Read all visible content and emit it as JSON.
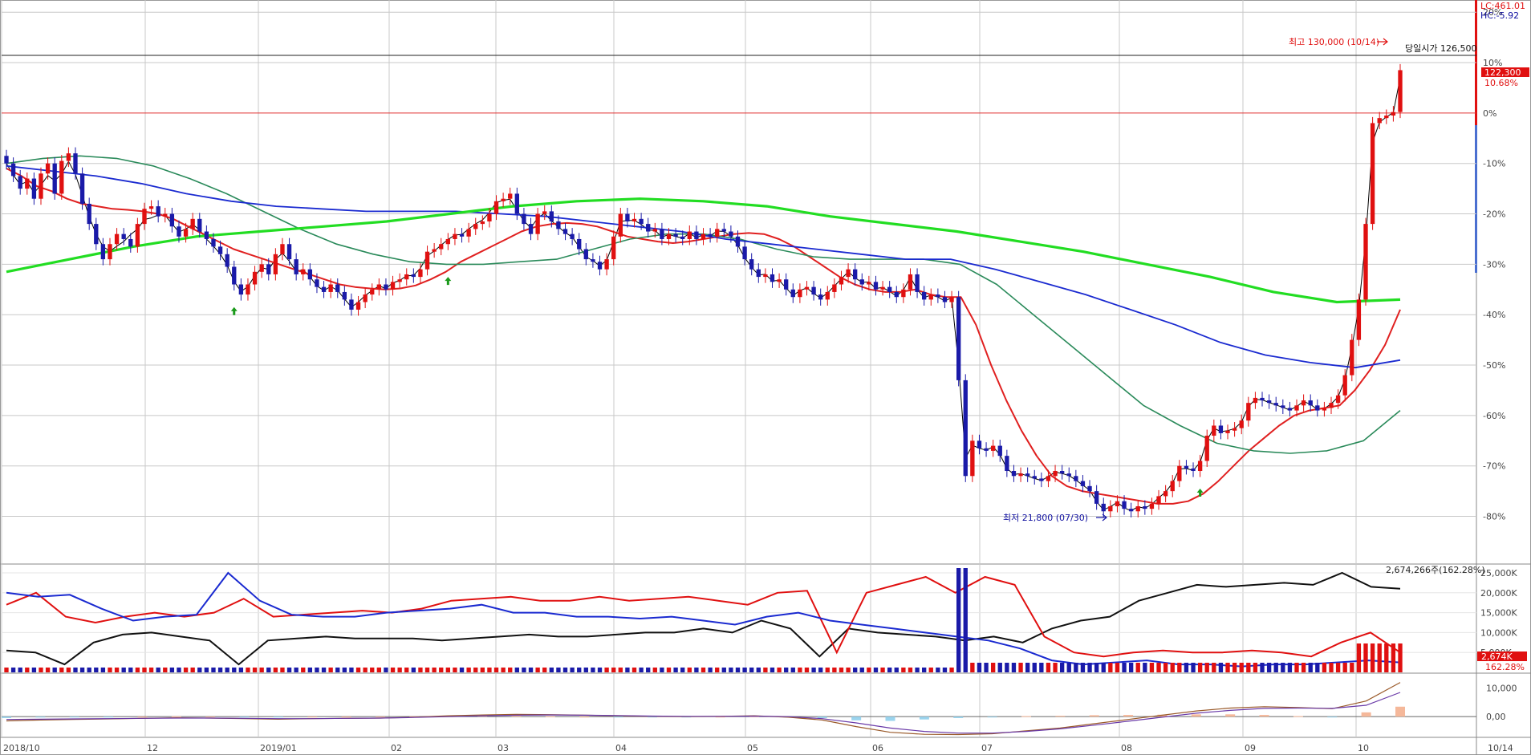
{
  "header": {
    "lc_label": "LC:461.01",
    "hc_label": "HC:-5.92"
  },
  "annotations": {
    "high": "최고 130,000 (10/14)",
    "open_today": "당일시가 126,500",
    "low": "최저 21,800 (07/30)"
  },
  "price_box": {
    "price": "122,300",
    "change": "10.68%"
  },
  "volume_panel": {
    "summary": "2,674,266주(162.28%)",
    "box_value": "2,674K",
    "box_pct": "162.28%"
  },
  "colors": {
    "up": "#e01010",
    "down": "#1a1aa8",
    "ma5": "#000000",
    "ma20": "#e02020",
    "ma60": "#2a8a5a",
    "ma120": "#1a2ad0",
    "ma240": "#22dd22",
    "grid": "#c8c8c8"
  },
  "chart_data": [
    {
      "type": "candlestick",
      "title": "",
      "x_ticks": [
        "2018/10",
        "12",
        "2019/01",
        "02",
        "03",
        "04",
        "05",
        "06",
        "07",
        "08",
        "09",
        "10",
        "10/14"
      ],
      "y_ticks": [
        "20%",
        "10%",
        "0%",
        "-10%",
        "-20%",
        "-30%",
        "-40%",
        "-50%",
        "-60%",
        "-70%",
        "-80%"
      ],
      "ylim": [
        -89.3,
        22.1
      ],
      "grid": true,
      "series": [
        {
          "name": "price",
          "values": [
            -10.0,
            -12.5,
            -15.0,
            -13.0,
            -17.0,
            -12.0,
            -10.0,
            -16.0,
            -9.5,
            -8.0,
            -12.0,
            -18.0,
            -22.0,
            -26.0,
            -29.0,
            -26.0,
            -24.0,
            -25.0,
            -26.5,
            -22.0,
            -19.0,
            -18.5,
            -20.5,
            -20.0,
            -22.5,
            -24.5,
            -23.0,
            -21.0,
            -23.5,
            -25.0,
            -26.5,
            -28.0,
            -30.5,
            -34.0,
            -36.0,
            -34.0,
            -31.5,
            -30.0,
            -32.0,
            -28.0,
            -26.0,
            -29.0,
            -32.0,
            -31.0,
            -33.0,
            -34.5,
            -35.5,
            -34.0,
            -35.5,
            -37.0,
            -39.0,
            -37.5,
            -36.0,
            -35.0,
            -34.0,
            -35.0,
            -33.5,
            -33.0,
            -32.0,
            -32.5,
            -31.0,
            -27.5,
            -27.0,
            -26.0,
            -25.0,
            -24.0,
            -24.5,
            -23.0,
            -22.0,
            -21.5,
            -20.0,
            -17.5,
            -17.0,
            -16.0,
            -20.0,
            -22.0,
            -24.0,
            -20.0,
            -19.5,
            -21.5,
            -23.0,
            -24.0,
            -25.0,
            -27.0,
            -29.0,
            -29.5,
            -31.0,
            -29.0,
            -24.5,
            -20.0,
            -21.5,
            -21.0,
            -22.0,
            -23.5,
            -23.0,
            -25.0,
            -24.0,
            -24.5,
            -25.0,
            -23.5,
            -25.0,
            -24.0,
            -24.5,
            -23.0,
            -23.5,
            -24.5,
            -26.5,
            -29.0,
            -31.0,
            -32.5,
            -32.0,
            -33.5,
            -33.0,
            -35.0,
            -36.5,
            -35.0,
            -34.5,
            -36.0,
            -37.0,
            -35.5,
            -34.0,
            -32.5,
            -31.0,
            -33.0,
            -34.0,
            -33.5,
            -35.0,
            -34.5,
            -35.5,
            -36.5,
            -35.0,
            -32.0,
            -35.5,
            -37.0,
            -36.0,
            -36.5,
            -37.5,
            -36.5,
            -53.0,
            -72.0,
            -65.0,
            -66.5,
            -67.0,
            -66.0,
            -68.0,
            -71.0,
            -72.0,
            -71.5,
            -72.0,
            -72.5,
            -73.0,
            -72.0,
            -71.0,
            -71.5,
            -72.0,
            -73.0,
            -74.0,
            -75.0,
            -77.5,
            -79.0,
            -78.0,
            -77.0,
            -78.5,
            -79.0,
            -78.0,
            -78.5,
            -77.5,
            -76.0,
            -75.0,
            -73.0,
            -70.0,
            -70.5,
            -71.0,
            -69.0,
            -64.0,
            -62.0,
            -63.5,
            -63.0,
            -62.5,
            -61.0,
            -57.5,
            -56.5,
            -57.0,
            -57.5,
            -58.0,
            -58.5,
            -59.0,
            -58.0,
            -57.0,
            -58.0,
            -59.0,
            -58.5,
            -57.5,
            -56.0,
            -52.0,
            -45.0,
            -37.0,
            -22.0,
            -2.0,
            -1.0,
            -0.5,
            0.2,
            8.5
          ]
        },
        {
          "name": "MA5",
          "values": [
            -10.0,
            -12.3,
            -14.2,
            -13.6,
            -15.8,
            -14.3,
            -12.4,
            -13.4,
            -12.1,
            -9.6,
            -12.2,
            -16.3,
            -20.6,
            -24.0,
            -26.5,
            -27.4,
            -26.4,
            -25.5,
            -24.1,
            -23.0,
            -21.1,
            -20.8,
            -20.2,
            -20.3,
            -22.0,
            -23.6,
            -23.0,
            -22.1,
            -23.2,
            -25.0,
            -26.4,
            -28.0,
            -30.2,
            -33.4,
            -35.4,
            -34.4,
            -32.3,
            -30.7,
            -31.0,
            -29.0,
            -27.8,
            -29.4,
            -31.4,
            -31.1,
            -32.5,
            -34.3,
            -35.2,
            -34.4,
            -35.2,
            -36.9,
            -38.5,
            -37.5,
            -36.2,
            -35.2,
            -34.3,
            -34.8,
            -33.7,
            -33.2,
            -32.3,
            -32.2,
            -30.8,
            -28.3,
            -27.4,
            -26.2,
            -25.1,
            -24.2,
            -24.1,
            -23.0,
            -22.0,
            -21.2,
            -19.7,
            -17.8,
            -17.3,
            -17.1,
            -19.3,
            -21.4,
            -22.8,
            -20.8,
            -19.9,
            -21.4,
            -22.6,
            -23.7,
            -24.6,
            -26.5,
            -28.5,
            -29.3,
            -30.3,
            -29.2,
            -25.6,
            -21.5,
            -21.3,
            -21.3,
            -22.1,
            -23.2,
            -23.3,
            -24.6,
            -24.1,
            -24.5,
            -24.8,
            -23.9,
            -24.7,
            -24.2,
            -24.4,
            -23.4,
            -23.5,
            -24.4,
            -26.2,
            -28.7,
            -30.6,
            -32.1,
            -32.0,
            -33.3,
            -33.2,
            -34.7,
            -36.2,
            -35.2,
            -34.7,
            -35.8,
            -36.7,
            -35.7,
            -34.3,
            -32.9,
            -31.5,
            -32.7,
            -33.6,
            -33.5,
            -34.8,
            -34.6,
            -35.4,
            -36.3,
            -35.1,
            -32.6,
            -35.0,
            -36.6,
            -36.1,
            -36.5,
            -37.3,
            -36.6,
            -50.1,
            -68.4,
            -65.9,
            -66.5,
            -66.9,
            -66.2,
            -67.8,
            -70.5,
            -71.7,
            -71.5,
            -72.0,
            -72.5,
            -72.9,
            -72.1,
            -71.2,
            -71.5,
            -71.9,
            -72.8,
            -73.8,
            -74.8,
            -77.1,
            -78.7,
            -78.1,
            -77.2,
            -78.3,
            -78.9,
            -78.1,
            -78.4,
            -77.6,
            -76.3,
            -75.2,
            -73.4,
            -70.6,
            -70.5,
            -70.9,
            -69.3,
            -64.9,
            -62.5,
            -63.2,
            -63.0,
            -62.6,
            -61.3,
            -58.2,
            -56.8,
            -56.9,
            -57.4,
            -57.9,
            -58.4,
            -58.9,
            -58.2,
            -57.2,
            -57.8,
            -58.8,
            -58.6,
            -57.7,
            -56.3,
            -52.8,
            -46.4,
            -38.6,
            -25.0,
            -5.8,
            -1.8,
            -0.8,
            0.1,
            7.0
          ]
        },
        {
          "name": "MA20",
          "values": [
            -11.0,
            -12.5,
            -14.5,
            -15.5,
            -17.0,
            -18.0,
            -18.5,
            -19.0,
            -19.2,
            -19.5,
            -20.0,
            -21.0,
            -22.5,
            -24.0,
            -25.5,
            -27.0,
            -28.0,
            -29.0,
            -30.0,
            -31.0,
            -32.0,
            -33.0,
            -34.0,
            -34.5,
            -34.8,
            -35.0,
            -34.8,
            -34.2,
            -33.0,
            -31.5,
            -29.5,
            -28.0,
            -26.5,
            -25.0,
            -23.5,
            -22.5,
            -22.0,
            -21.8,
            -22.0,
            -22.5,
            -23.5,
            -24.5,
            -25.0,
            -25.5,
            -25.8,
            -25.5,
            -25.0,
            -24.5,
            -24.0,
            -23.8,
            -24.0,
            -25.0,
            -26.5,
            -28.5,
            -30.5,
            -32.5,
            -34.0,
            -35.0,
            -35.5,
            -35.5,
            -35.0,
            -36.0,
            -36.5,
            -36.5,
            -42.0,
            -50.0,
            -57.0,
            -63.0,
            -68.0,
            -72.0,
            -74.0,
            -75.0,
            -75.5,
            -76.0,
            -76.5,
            -77.0,
            -77.5,
            -77.5,
            -77.0,
            -75.5,
            -73.0,
            -70.0,
            -67.0,
            -64.5,
            -62.0,
            -60.0,
            -59.0,
            -58.5,
            -58.0,
            -55.0,
            -51.0,
            -46.0,
            -39.0
          ]
        },
        {
          "name": "MA60",
          "values": [
            -10.0,
            -9.0,
            -8.5,
            -9.0,
            -10.5,
            -13.0,
            -16.0,
            -19.5,
            -23.0,
            -26.0,
            -28.0,
            -29.5,
            -30.0,
            -30.0,
            -29.5,
            -29.0,
            -27.0,
            -25.0,
            -24.0,
            -24.0,
            -25.0,
            -27.0,
            -28.5,
            -29.0,
            -29.0,
            -29.0,
            -30.0,
            -34.0,
            -40.0,
            -46.0,
            -52.0,
            -58.0,
            -62.0,
            -65.5,
            -67.0,
            -67.5,
            -67.0,
            -65.0,
            -59.0
          ]
        },
        {
          "name": "MA120",
          "values": [
            -10.5,
            -11.5,
            -12.5,
            -14.0,
            -16.0,
            -17.5,
            -18.5,
            -19.0,
            -19.5,
            -19.5,
            -19.5,
            -20.0,
            -20.5,
            -21.5,
            -22.5,
            -23.5,
            -25.0,
            -26.0,
            -27.0,
            -28.0,
            -29.0,
            -29.0,
            -31.0,
            -33.5,
            -36.0,
            -39.0,
            -42.0,
            -45.5,
            -48.0,
            -49.5,
            -50.5,
            -49.0
          ]
        },
        {
          "name": "MA240",
          "values": [
            -31.5,
            -29.0,
            -26.5,
            -24.5,
            -23.5,
            -22.5,
            -21.5,
            -20.0,
            -18.5,
            -17.5,
            -17.0,
            -17.5,
            -18.5,
            -20.5,
            -22.0,
            -23.5,
            -25.5,
            -27.5,
            -30.0,
            -32.5,
            -35.5,
            -37.5,
            -37.0
          ]
        }
      ]
    },
    {
      "type": "line",
      "title": "",
      "y_ticks": [
        "25,000K",
        "20,000K",
        "15,000K",
        "10,000K",
        "5,000K"
      ],
      "ylim": [
        0,
        25000
      ],
      "series": [
        {
          "name": "line-black",
          "values": [
            5500,
            5000,
            2000,
            7500,
            9500,
            10000,
            9000,
            8000,
            2000,
            8000,
            8500,
            9000,
            8500,
            8500,
            8500,
            8000,
            8500,
            9000,
            9500,
            9000,
            9000,
            9500,
            10000,
            10000,
            11000,
            10000,
            13000,
            11000,
            4000,
            11000,
            10000,
            9500,
            9000,
            8000,
            9000,
            7500,
            11000,
            13000,
            14000,
            18000,
            20000,
            22000,
            21500,
            22000,
            22500,
            22000,
            25000,
            21500,
            21000
          ]
        },
        {
          "name": "line-red",
          "values": [
            17000,
            20000,
            14000,
            12500,
            14000,
            15000,
            14000,
            15000,
            18500,
            14000,
            14500,
            15000,
            15500,
            15000,
            16000,
            18000,
            18500,
            19000,
            18000,
            18000,
            19000,
            18000,
            18500,
            19000,
            18000,
            17000,
            20000,
            20500,
            5000,
            20000,
            22000,
            24000,
            20000,
            24000,
            22000,
            9000,
            5000,
            4000,
            5000,
            5500,
            5000,
            5000,
            5500,
            5000,
            4000,
            7500,
            10000,
            5000
          ]
        },
        {
          "name": "line-blue",
          "values": [
            20000,
            19000,
            19500,
            16000,
            13000,
            14000,
            14500,
            25000,
            18000,
            14500,
            14000,
            14000,
            15000,
            15500,
            16000,
            17000,
            15000,
            15000,
            14000,
            14000,
            13500,
            14000,
            13000,
            12000,
            14000,
            15000,
            13000,
            12000,
            11000,
            10000,
            9000,
            8000,
            6000,
            3000,
            2000,
            2500,
            3000,
            2000,
            2000,
            1500,
            2000,
            2000,
            2500,
            3000,
            2500
          ]
        }
      ]
    },
    {
      "type": "bar",
      "title": "",
      "y_ticks": [
        "10,000",
        "0,00"
      ],
      "ylim": [
        -7000,
        15000
      ],
      "series": [
        {
          "name": "macd",
          "values": [
            -1500,
            -1200,
            -1000,
            -800,
            -600,
            -400,
            -500,
            -700,
            -900,
            -700,
            -600,
            -500,
            -200,
            300,
            600,
            800,
            700,
            500,
            300,
            100,
            0,
            100,
            300,
            -200,
            -1200,
            -3500,
            -5500,
            -6200,
            -6300,
            -6000,
            -5000,
            -4000,
            -2500,
            -1000,
            500,
            2000,
            3000,
            3500,
            3200,
            2800,
            5500,
            12000
          ]
        },
        {
          "name": "signal",
          "values": [
            -1000,
            -900,
            -800,
            -700,
            -600,
            -500,
            -500,
            -600,
            -700,
            -700,
            -600,
            -500,
            -300,
            0,
            300,
            500,
            600,
            500,
            400,
            200,
            100,
            100,
            200,
            0,
            -700,
            -2200,
            -4000,
            -5200,
            -5800,
            -5800,
            -5200,
            -4300,
            -3000,
            -1600,
            -200,
            1200,
            2200,
            2900,
            3000,
            2900,
            4000,
            8500
          ]
        }
      ]
    }
  ]
}
